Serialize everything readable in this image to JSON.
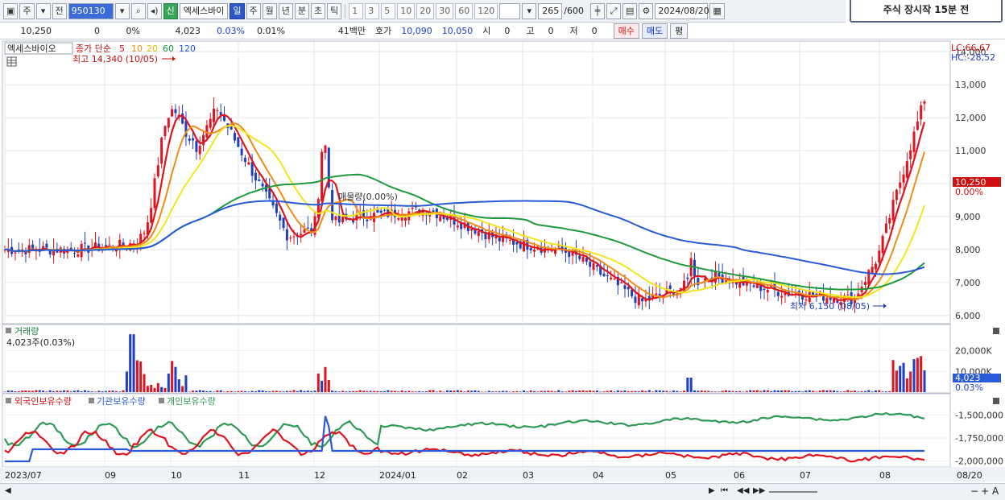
{
  "toolbar": {
    "market": "주",
    "kind": "전",
    "code": "950130",
    "name": "엑세스바이",
    "new_badge": "신",
    "periods": [
      "일",
      "주",
      "월",
      "년",
      "분",
      "초",
      "틱"
    ],
    "active_period": "일",
    "minutes": [
      "1",
      "3",
      "5",
      "10",
      "20",
      "30",
      "60",
      "120"
    ],
    "count": "265",
    "count_total": "/600",
    "date": "2024/08/20"
  },
  "notice": "주식 장시작 15분 전",
  "quote": {
    "price": "10,250",
    "change": "0",
    "change_pct": "0%",
    "volume": "4,023",
    "volume_pct": "0.03%",
    "turnover_pct": "0.01%",
    "amount": "41백만",
    "hoga_label": "호가",
    "ask": "10,090",
    "bid": "10,050",
    "open_label": "시",
    "open": "0",
    "high_label": "고",
    "high": "0",
    "low_label": "저",
    "low": "0",
    "buy": "매수",
    "sell": "매도",
    "eval": "평"
  },
  "price_panel": {
    "title": "엑세스바이오",
    "ma_label": "종가 단순",
    "ma_periods": [
      "5",
      "10",
      "20",
      "60",
      "120"
    ],
    "lc": "LC:66,67",
    "hc": "HC:-28,52",
    "high_marker": "최고 14,340 (10/05)",
    "low_marker": "최저 6,150 (08/05)",
    "event_label": "매물량(0.00%)",
    "current_price": "10,250",
    "current_pct": "0.00%",
    "y_ticks": [
      "14,000",
      "13,000",
      "12,000",
      "11,000",
      "10,000",
      "9,000",
      "8,000",
      "7,000",
      "6,000"
    ]
  },
  "volume_panel": {
    "title": "거래량",
    "value": "4,023주(0.03%)",
    "y_ticks": [
      "20,000K",
      "10,000K"
    ],
    "current": "4,023",
    "current_pct": "0.03%"
  },
  "holding_panel": {
    "legend": [
      "외국인보유수량",
      "기관보유수량",
      "개인보유수량"
    ],
    "y_ticks": [
      "-1,500,000",
      "-1,750,000",
      "-2,000,000"
    ]
  },
  "x_axis": [
    "2023/07",
    "09",
    "10",
    "11",
    "12",
    "2024/01",
    "02",
    "03",
    "04",
    "05",
    "06",
    "07",
    "08",
    "08/20"
  ],
  "colors": {
    "up": "#e0141e",
    "down": "#1f3fbf",
    "ma5": "#e0141e",
    "ma10": "#f08c14",
    "ma20": "#f2e61a",
    "ma60": "#1e9a3c",
    "ma120": "#2a5ad8",
    "foreign": "#e0141e",
    "institution": "#2a5ad8",
    "individual": "#2e9a55"
  },
  "chart_data": {
    "type": "line",
    "price_anchors": {
      "x": [
        "2023/07",
        "2023/08",
        "2023/09",
        "2023/10",
        "2023/11",
        "2023/12",
        "2024/01",
        "2024/02",
        "2024/03",
        "2024/04",
        "2024/05",
        "2024/06",
        "2024/07",
        "2024/08"
      ],
      "close": [
        8000,
        8000,
        8200,
        12300,
        8400,
        9000,
        9200,
        8300,
        7900,
        6400,
        7200,
        6700,
        6500,
        10250
      ]
    },
    "ylim": [
      5800,
      14300
    ]
  }
}
